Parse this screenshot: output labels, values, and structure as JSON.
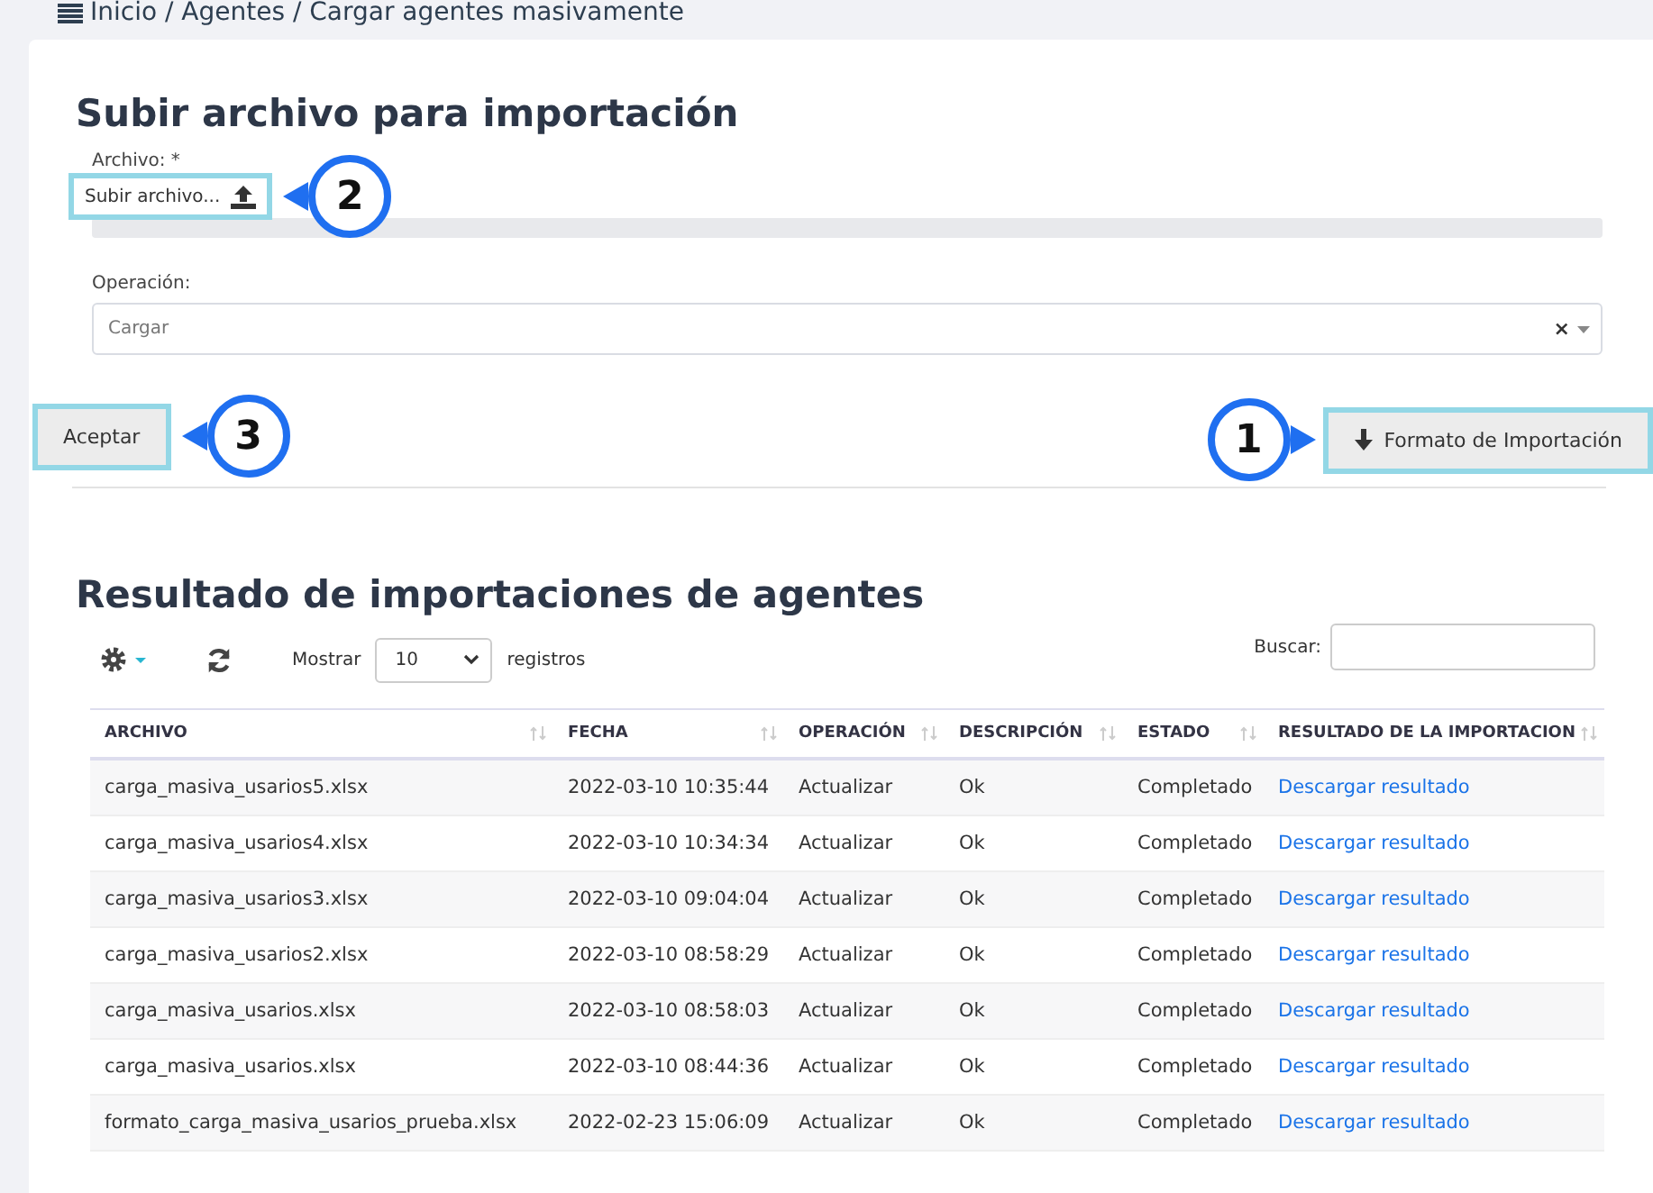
{
  "breadcrumb": "Inicio / Agentes / Cargar agentes masivamente",
  "upload": {
    "title": "Subir archivo para importación",
    "file_label": "Archivo: *",
    "file_button": "Subir archivo...",
    "file_callout": "2",
    "accept_callout": "3",
    "format_callout": "1",
    "operation_label": "Operación:",
    "operation_value": "Cargar",
    "clear": "×",
    "accept": "Aceptar",
    "format_button": "Formato de Importación"
  },
  "results": {
    "title": "Resultado de importaciones de agentes",
    "show_label": "Mostrar",
    "page_size": "10",
    "records_label": "registros",
    "search_label": "Buscar:",
    "columns": [
      "ARCHIVO",
      "FECHA",
      "OPERACIÓN",
      "DESCRIPCIÓN",
      "ESTADO",
      "RESULTADO DE LA IMPORTACION"
    ],
    "rows": [
      {
        "file": "carga_masiva_usarios5.xlsx",
        "date": "2022-03-10 10:35:44",
        "operation": "Actualizar",
        "description": "Ok",
        "status": "Completado",
        "result": "Descargar resultado"
      },
      {
        "file": "carga_masiva_usarios4.xlsx",
        "date": "2022-03-10 10:34:34",
        "operation": "Actualizar",
        "description": "Ok",
        "status": "Completado",
        "result": "Descargar resultado"
      },
      {
        "file": "carga_masiva_usarios3.xlsx",
        "date": "2022-03-10 09:04:04",
        "operation": "Actualizar",
        "description": "Ok",
        "status": "Completado",
        "result": "Descargar resultado"
      },
      {
        "file": "carga_masiva_usarios2.xlsx",
        "date": "2022-03-10 08:58:29",
        "operation": "Actualizar",
        "description": "Ok",
        "status": "Completado",
        "result": "Descargar resultado"
      },
      {
        "file": "carga_masiva_usarios.xlsx",
        "date": "2022-03-10 08:58:03",
        "operation": "Actualizar",
        "description": "Ok",
        "status": "Completado",
        "result": "Descargar resultado"
      },
      {
        "file": "carga_masiva_usarios.xlsx",
        "date": "2022-03-10 08:44:36",
        "operation": "Actualizar",
        "description": "Ok",
        "status": "Completado",
        "result": "Descargar resultado"
      },
      {
        "file": "formato_carga_masiva_usarios_prueba.xlsx",
        "date": "2022-02-23 15:06:09",
        "operation": "Actualizar",
        "description": "Ok",
        "status": "Completado",
        "result": "Descargar resultado"
      }
    ]
  }
}
